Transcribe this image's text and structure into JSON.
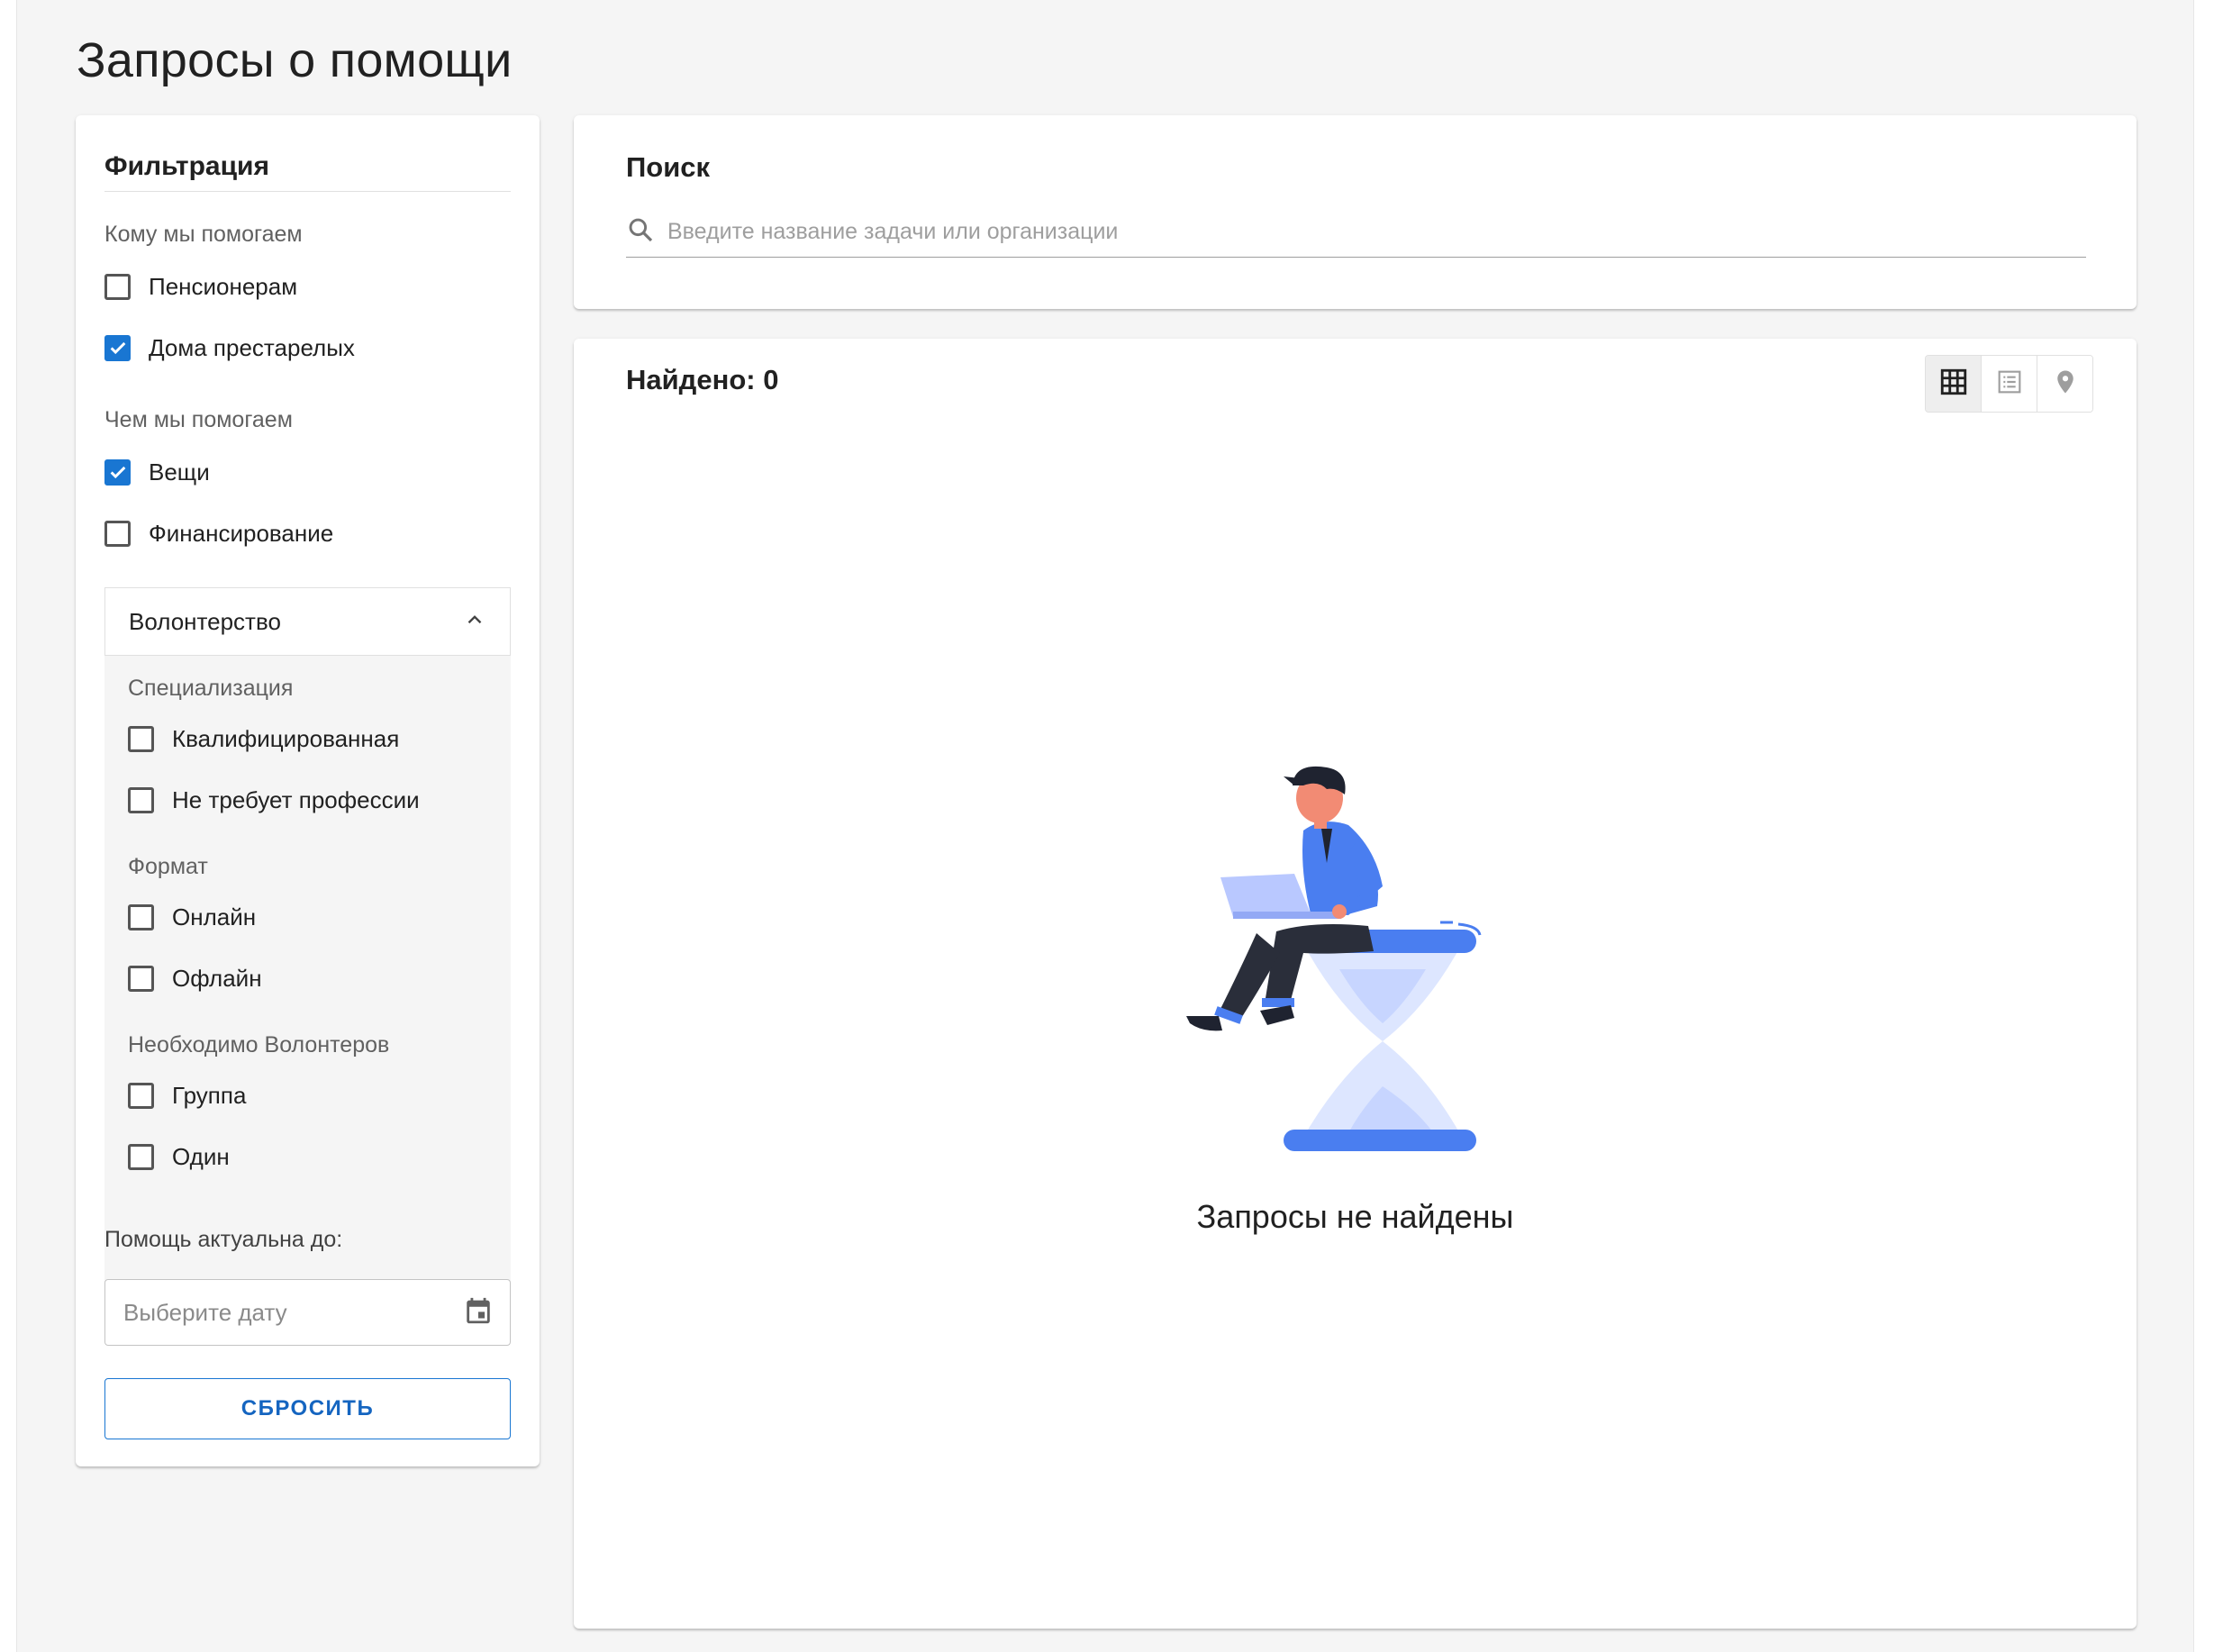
{
  "page": {
    "title": "Запросы о помощи"
  },
  "filters": {
    "title": "Фильтрация",
    "who": {
      "label": "Кому мы помогаем",
      "options": [
        {
          "label": "Пенсионерам",
          "checked": false
        },
        {
          "label": "Дома престарелых",
          "checked": true
        }
      ]
    },
    "what": {
      "label": "Чем мы помогаем",
      "options": [
        {
          "label": "Вещи",
          "checked": true
        },
        {
          "label": "Финансирование",
          "checked": false
        }
      ]
    },
    "volunteering": {
      "label": "Волонтерство",
      "expanded": true,
      "specialization": {
        "label": "Специализация",
        "options": [
          {
            "label": "Квалифицированная",
            "checked": false
          },
          {
            "label": "Не требует профессии",
            "checked": false
          }
        ]
      },
      "format": {
        "label": "Формат",
        "options": [
          {
            "label": "Онлайн",
            "checked": false
          },
          {
            "label": "Офлайн",
            "checked": false
          }
        ]
      },
      "volunteers_needed": {
        "label": "Необходимо Волонтеров",
        "options": [
          {
            "label": "Группа",
            "checked": false
          },
          {
            "label": "Один",
            "checked": false
          }
        ]
      }
    },
    "date": {
      "label": "Помощь актуальна до:",
      "placeholder": "Выберите дату",
      "value": ""
    },
    "reset_label": "СБРОСИТЬ"
  },
  "search": {
    "title": "Поиск",
    "placeholder": "Введите название задачи или организации",
    "value": ""
  },
  "results": {
    "found_label": "Найдено: 0",
    "view_modes": [
      {
        "icon": "grid-icon",
        "active": true
      },
      {
        "icon": "list-icon",
        "active": false
      },
      {
        "icon": "map-pin-icon",
        "active": false
      }
    ],
    "empty_text": "Запросы не найдены"
  },
  "colors": {
    "accent": "#1976d2",
    "illustration_blue": "#4a7ef0",
    "illustration_light": "#dde6ff",
    "background": "#f5f5f5"
  }
}
